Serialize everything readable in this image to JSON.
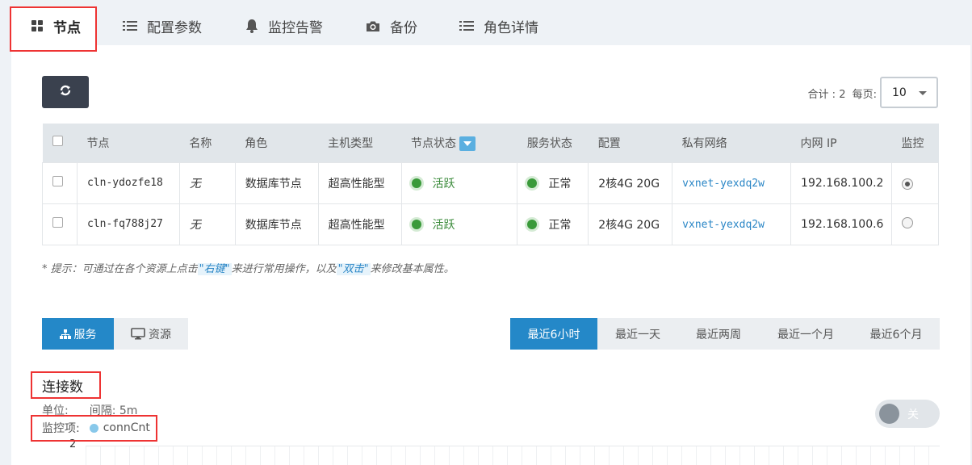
{
  "tabs": [
    {
      "label": "节点",
      "icon": "grid-icon",
      "active": true
    },
    {
      "label": "配置参数",
      "icon": "list-icon"
    },
    {
      "label": "监控告警",
      "icon": "bell-icon"
    },
    {
      "label": "备份",
      "icon": "camera-icon"
    },
    {
      "label": "角色详情",
      "icon": "list-icon"
    }
  ],
  "toolbar": {
    "refresh_icon": "refresh-icon",
    "total_label": "合计 : 2",
    "per_page_label": "每页:",
    "per_page_value": "10"
  },
  "table": {
    "headers": [
      "节点",
      "名称",
      "角色",
      "主机类型",
      "节点状态",
      "服务状态",
      "配置",
      "私有网络",
      "内网 IP",
      "监控"
    ],
    "rows": [
      {
        "node": "cln-ydozfe18",
        "name": "无",
        "role": "数据库节点",
        "host_type": "超高性能型",
        "node_status": "活跃",
        "service_status": "正常",
        "config": "2核4G 20G",
        "vxnet": "vxnet-yexdq2w",
        "ip": "192.168.100.2",
        "monitor_selected": true
      },
      {
        "node": "cln-fq788j27",
        "name": "无",
        "role": "数据库节点",
        "host_type": "超高性能型",
        "node_status": "活跃",
        "service_status": "正常",
        "config": "2核4G 20G",
        "vxnet": "vxnet-yexdq2w",
        "ip": "192.168.100.6",
        "monitor_selected": false
      }
    ]
  },
  "tip": {
    "prefix": "* 提示：可通过在各个资源上点击",
    "right_click": "\"右键\"",
    "middle": "来进行常用操作，以及",
    "double_click": "\"双击\"",
    "suffix": "来修改基本属性。"
  },
  "subtabs": [
    {
      "label": "服务",
      "icon": "sitemap-icon",
      "active": true
    },
    {
      "label": "资源",
      "icon": "monitor-icon"
    }
  ],
  "ranges": [
    {
      "label": "最近6小时",
      "active": true
    },
    {
      "label": "最近一天"
    },
    {
      "label": "最近两周"
    },
    {
      "label": "最近一个月"
    },
    {
      "label": "最近6个月"
    }
  ],
  "chart": {
    "title": "连接数",
    "unit_label": "单位:",
    "interval_label": "间隔: 5m",
    "monitor_label": "监控项:",
    "metric": "connCnt",
    "toggle_label": "关",
    "y_top": "2"
  },
  "colors": {
    "accent": "#2488c8",
    "active_status": "#3a9a3a",
    "highlight_box": "#e33333"
  }
}
